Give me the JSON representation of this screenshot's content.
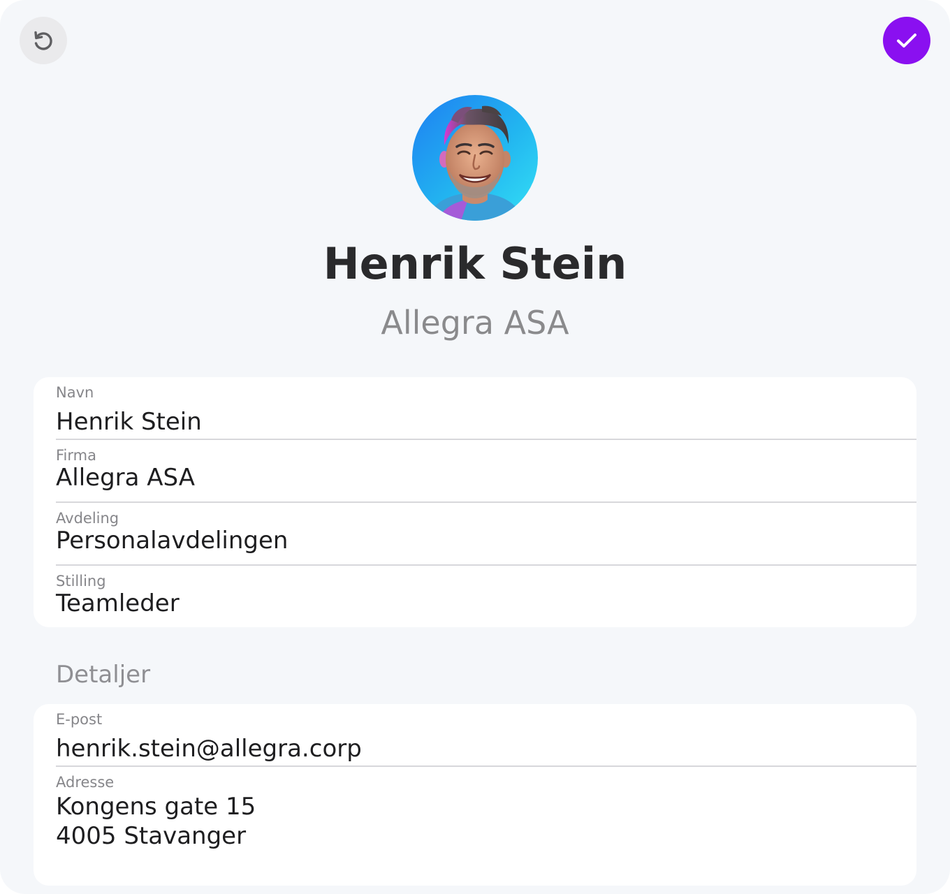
{
  "header": {
    "undo_icon": "undo-icon",
    "confirm_icon": "checkmark-icon",
    "accent_color": "#8a10f0"
  },
  "profile": {
    "name": "Henrik Stein",
    "company": "Allegra ASA",
    "avatar_icon": "avatar-photo"
  },
  "fields": [
    {
      "label": "Navn",
      "value": "Henrik Stein"
    },
    {
      "label": "Firma",
      "value": "Allegra ASA"
    },
    {
      "label": "Avdeling",
      "value": "Personalavdelingen"
    },
    {
      "label": "Stilling",
      "value": "Teamleder"
    }
  ],
  "details": {
    "title": "Detaljer",
    "email": {
      "label": "E-post",
      "value": "henrik.stein@allegra.corp"
    },
    "address": {
      "label": "Adresse",
      "line1": "Kongens gate 15",
      "line2": "4005 Stavanger"
    }
  }
}
